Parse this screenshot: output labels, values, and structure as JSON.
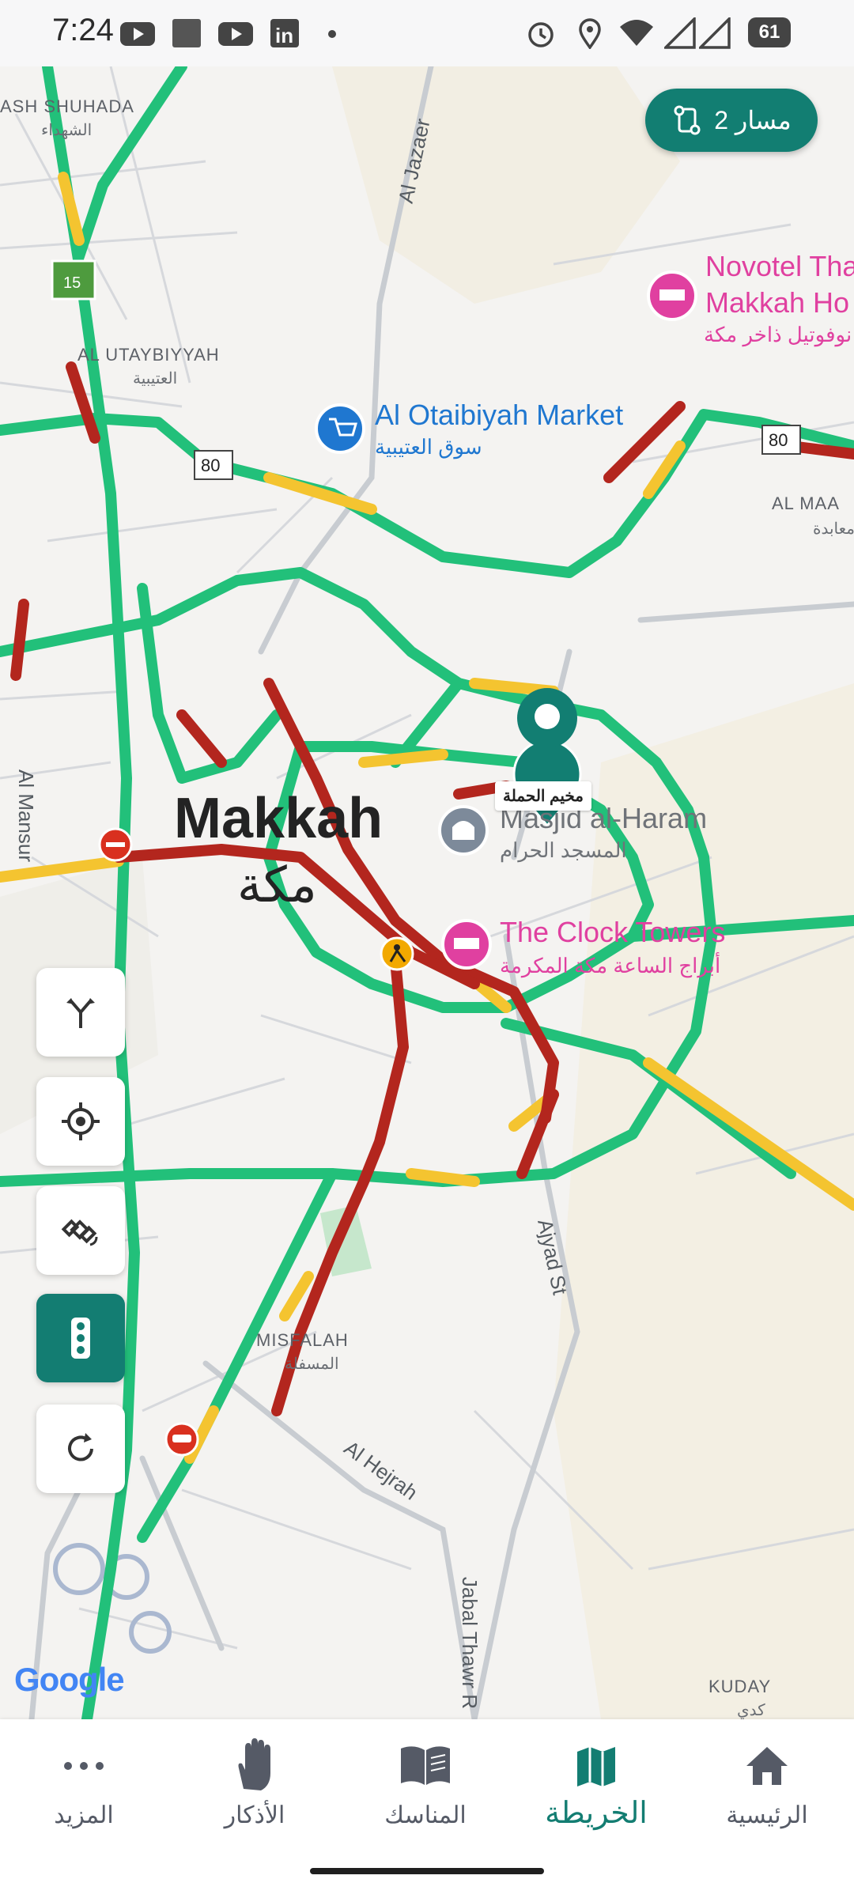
{
  "status_bar": {
    "time": "7:24",
    "battery": "61",
    "icons": [
      "youtube-icon",
      "square-icon",
      "youtube-icon",
      "linkedin-icon",
      "dot-icon",
      "alarm-icon",
      "location-icon",
      "wifi-icon",
      "signal-icon",
      "signal-icon",
      "battery-icon"
    ]
  },
  "route_button": {
    "label": "2 مسار",
    "icon": "route-icon",
    "color": "#127e72"
  },
  "map": {
    "labels": {
      "shuhada": "ASH SHUHADA",
      "shuhada_ar": "الشهداء",
      "utaybiyyah": "AL UTAYBIYYAH",
      "utaybiyyah_ar": "العتيبية",
      "al_jazaer": "Al Jazaer",
      "otaibiyah_market": "Al Otaibiyah Market",
      "otaibiyah_market_ar": "سوق العتيبية",
      "novotel_1": "Novotel Tha",
      "novotel_2": "Makkah Ho",
      "novotel_ar": "نوفوتيل ذاخر مكة",
      "al_maa": "AL MAA",
      "al_maa_ar": "معابدة",
      "makkah": "Makkah",
      "makkah_ar": "مكة",
      "masjid": "Masjid al-Haram",
      "masjid_ar": "المسجد الحرام",
      "clock_towers": "The Clock Towers",
      "clock_towers_ar": "أبراج الساعة مكة المكرمة",
      "al_mansur": "Al Mansur",
      "ajyad": "Ajyad St",
      "misfalah": "MISFALAH",
      "misfalah_ar": "المسفلة",
      "al_hejrah": "Al Hejrah",
      "jabal_thawr": "Jabal Thawr R",
      "kuday": "KUDAY",
      "kuday_ar": "كدي",
      "route_15": "15",
      "route_80a": "80",
      "route_80b": "80"
    },
    "pin_label": "مخيم الحملة",
    "attribution": "Google"
  },
  "map_controls": [
    {
      "name": "routes-button",
      "icon": "fork-arrows-icon"
    },
    {
      "name": "my-location-button",
      "icon": "crosshair-icon"
    },
    {
      "name": "satellite-button",
      "icon": "satellite-icon"
    },
    {
      "name": "traffic-button",
      "icon": "traffic-light-icon",
      "active": true
    },
    {
      "name": "refresh-button",
      "icon": "refresh-icon"
    }
  ],
  "bottom_nav": {
    "items": [
      {
        "label": "المزيد",
        "icon": "more-dots-icon"
      },
      {
        "label": "الأذكار",
        "icon": "hand-icon"
      },
      {
        "label": "المناسك",
        "icon": "book-icon"
      },
      {
        "label": "الخريطة",
        "icon": "map-icon",
        "active": true
      },
      {
        "label": "الرئيسية",
        "icon": "home-icon"
      }
    ]
  },
  "colors": {
    "accent": "#137d72",
    "traffic_green": "#22c07a",
    "traffic_yellow": "#f4c430",
    "traffic_red": "#b3261e",
    "poi_pink": "#e040a0",
    "poi_blue": "#1f77d0"
  }
}
